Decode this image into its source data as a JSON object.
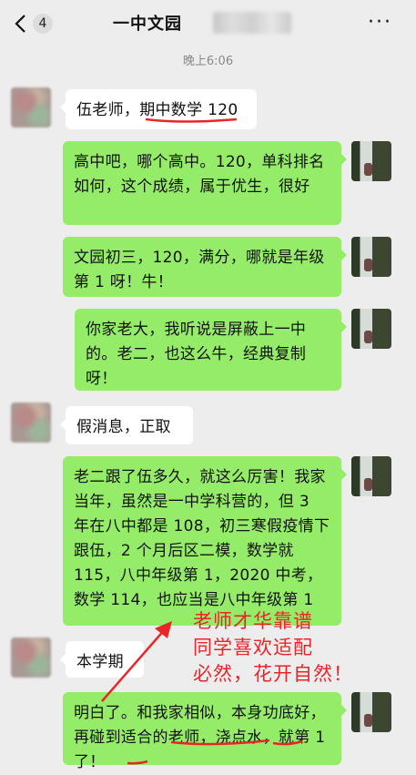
{
  "header": {
    "unread_count": "4",
    "title": "一中文园"
  },
  "timestamp": "晚上6:06",
  "messages": [
    {
      "side": "left",
      "text": "伍老师，期中数学 120"
    },
    {
      "side": "right",
      "text": "高中吧，哪个高中。120，单科排名如何，这个成绩，属于优生，很好"
    },
    {
      "side": "right",
      "text": "文园初三，120，满分，哪就是年级第 1 呀！牛！"
    },
    {
      "side": "right",
      "text": "你家老大，我听说是屏蔽上一中的。老二，也这么牛，经典复制呀！"
    },
    {
      "side": "left",
      "text": "假消息，正取"
    },
    {
      "side": "right",
      "text": "老二跟了伍多久，就这么厉害！我家当年，虽然是一中学科营的，但 3 年在八中都是 108，初三寒假疫情下跟伍，2 个月后区二模，数学就 115，八中年级第 1，2020 中考，数学 114，也应当是八中年级第 1"
    },
    {
      "side": "left",
      "text": "本学期"
    },
    {
      "side": "right",
      "text": "明白了。和我家相似，本身功底好，再碰到适合的老师，浇点水，就第 1 了！"
    }
  ],
  "annotation": {
    "lines": [
      "老师才华靠谱",
      "同学喜欢适配",
      "必然，花开自然！"
    ],
    "color": "#e8262a"
  },
  "colors": {
    "background": "#ededed",
    "bubble_green": "#95ec69",
    "bubble_white": "#ffffff"
  },
  "icons": [
    "back-arrow-icon",
    "more-dots-icon"
  ]
}
